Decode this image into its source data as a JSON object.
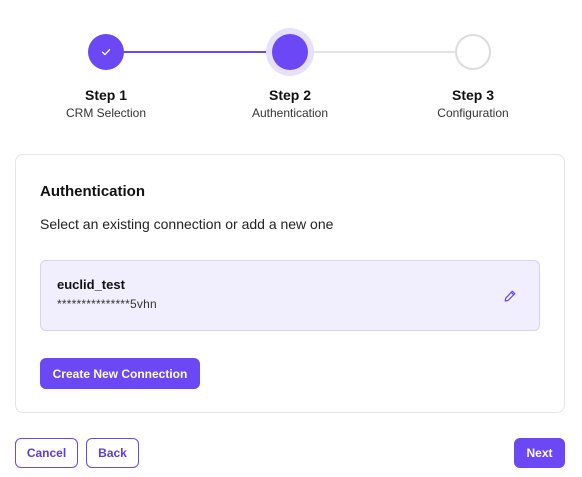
{
  "stepper": {
    "steps": [
      {
        "title": "Step 1",
        "subtitle": "CRM Selection",
        "state": "complete"
      },
      {
        "title": "Step 2",
        "subtitle": "Authentication",
        "state": "active"
      },
      {
        "title": "Step 3",
        "subtitle": "Configuration",
        "state": "pending"
      }
    ]
  },
  "card": {
    "title": "Authentication",
    "description": "Select an existing connection or add a new one",
    "connection": {
      "name": "euclid_test",
      "masked_key": "***************5vhn"
    },
    "create_label": "Create New Connection"
  },
  "footer": {
    "cancel_label": "Cancel",
    "back_label": "Back",
    "next_label": "Next"
  },
  "colors": {
    "accent": "#6b47f5",
    "accent_light": "#f1eefd",
    "border": "#e4e4e7"
  },
  "icons": {
    "step1": "check-icon",
    "edit": "pencil-icon"
  }
}
